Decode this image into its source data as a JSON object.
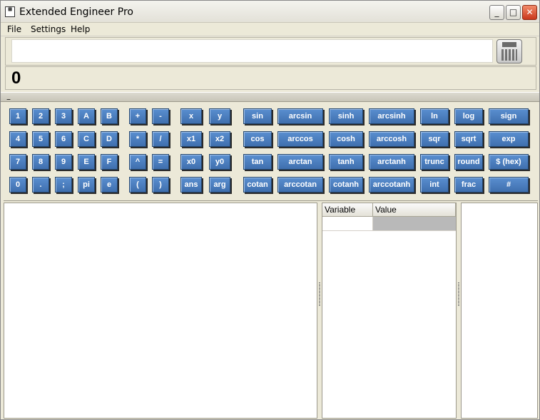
{
  "window": {
    "title": "Extended Engineer Pro",
    "app_icon_glyph": "▦"
  },
  "controls": {
    "minimize": "_",
    "maximize": "□",
    "close": "✕"
  },
  "menu": [
    {
      "label": "File"
    },
    {
      "label": "Settings"
    },
    {
      "label": "Help"
    }
  ],
  "input": {
    "value": "",
    "placeholder": ""
  },
  "result": {
    "value": "0"
  },
  "splitter": {
    "label": "–"
  },
  "keys": {
    "row1": [
      "1",
      "2",
      "3",
      "A",
      "B",
      "+",
      "-",
      "x",
      "y",
      "sin",
      "arcsin",
      "sinh",
      "arcsinh",
      "ln",
      "log",
      "sign"
    ],
    "row2": [
      "4",
      "5",
      "6",
      "C",
      "D",
      "*",
      "/",
      "x1",
      "x2",
      "cos",
      "arccos",
      "cosh",
      "arccosh",
      "sqr",
      "sqrt",
      "exp"
    ],
    "row3": [
      "7",
      "8",
      "9",
      "E",
      "F",
      "^",
      "=",
      "x0",
      "y0",
      "tan",
      "arctan",
      "tanh",
      "arctanh",
      "trunc",
      "round",
      "$ (hex)"
    ],
    "row4": [
      "0",
      ".",
      ";",
      "pi",
      "e",
      "(",
      ")",
      "ans",
      "arg",
      "cotan",
      "arccotan",
      "cotanh",
      "arccotanh",
      "int",
      "frac",
      "#"
    ]
  },
  "variables": {
    "columns": [
      "Variable",
      "Value"
    ],
    "rows": [
      {
        "variable": "",
        "value": ""
      }
    ]
  },
  "colors": {
    "key_face": "#4a7fc0",
    "key_text": "#ffffff",
    "window_bg": "#ece9d8"
  }
}
